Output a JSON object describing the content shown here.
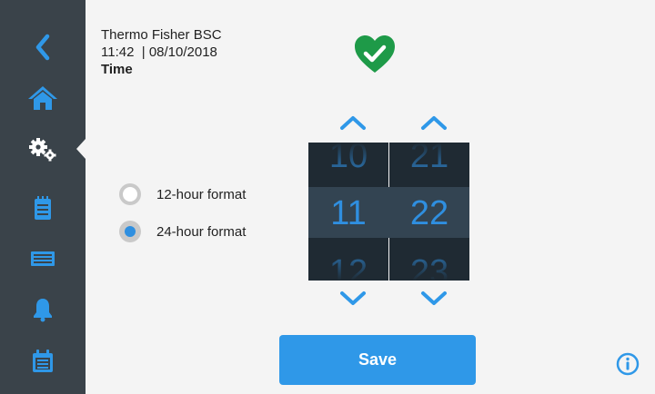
{
  "header": {
    "device_name": "Thermo Fisher BSC",
    "datetime": "11:42  | 08/10/2018",
    "page_title": "Time"
  },
  "sidebar": {
    "items": [
      {
        "icon": "back-icon"
      },
      {
        "icon": "home-icon"
      },
      {
        "icon": "settings-icon",
        "active": true
      },
      {
        "icon": "log-icon"
      },
      {
        "icon": "display-icon"
      },
      {
        "icon": "alarm-bell-icon"
      },
      {
        "icon": "calendar-icon"
      }
    ]
  },
  "status": {
    "icon": "health-heart-check-icon",
    "color": "#1e9a48"
  },
  "time_format": {
    "options": [
      {
        "label": "12-hour format",
        "selected": false
      },
      {
        "label": "24-hour format",
        "selected": true
      }
    ]
  },
  "picker": {
    "hours": {
      "prev": "10",
      "current": "11",
      "next": "12"
    },
    "minutes": {
      "prev": "21",
      "current": "22",
      "next": "23"
    }
  },
  "actions": {
    "save_label": "Save"
  },
  "colors": {
    "accent": "#2f8fe0",
    "sidebar": "#3a434a",
    "status_ok": "#1e9a48"
  }
}
